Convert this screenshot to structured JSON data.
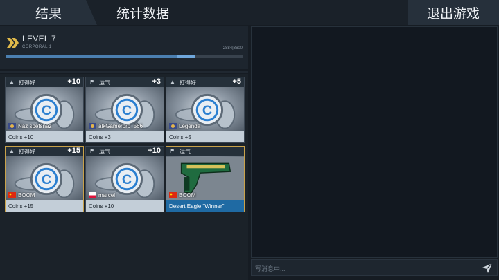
{
  "tabs": {
    "results": "结果",
    "stats": "统计数据",
    "exit": "退出游戏"
  },
  "level": {
    "title": "LEVEL 7",
    "rank": "CORPORAL 1",
    "xp_text": "2884|3600",
    "xp_fraction": 0.72,
    "xp_gain_fraction": 0.08
  },
  "cards": [
    {
      "category": "打得好",
      "category_icon": "thumbs-up-icon",
      "points": "+10",
      "player": "Naz spetsnaz",
      "flag": "avatar",
      "reward": "Coins +10",
      "highlight": false
    },
    {
      "category": "运气",
      "category_icon": "luck-icon",
      "points": "+3",
      "player": "alkGamerpro_566",
      "flag": "avatar",
      "reward": "Coins +3",
      "highlight": false
    },
    {
      "category": "打得好",
      "category_icon": "thumbs-up-icon",
      "points": "+5",
      "player": "Legenda",
      "flag": "avatar",
      "reward": "Coins +5",
      "highlight": false
    },
    {
      "category": "打得好",
      "category_icon": "thumbs-up-icon",
      "points": "+15",
      "player": "BOOM",
      "flag": "china",
      "reward": "Coins +15",
      "highlight": true
    },
    {
      "category": "运气",
      "category_icon": "luck-icon",
      "points": "+10",
      "player": "marcel",
      "flag": "poland",
      "reward": "Coins +10",
      "highlight": false
    },
    {
      "category": "运气",
      "category_icon": "luck-icon",
      "points": "",
      "player": "BOOM",
      "flag": "china",
      "reward": "Desert Eagle \"Winner\"",
      "highlight": true
    }
  ],
  "chat": {
    "placeholder": "写消息中..."
  },
  "colors": {
    "accent": "#c9a24a",
    "xp": "#4b7fb0",
    "weapon_reward": "#1f6aa3"
  }
}
